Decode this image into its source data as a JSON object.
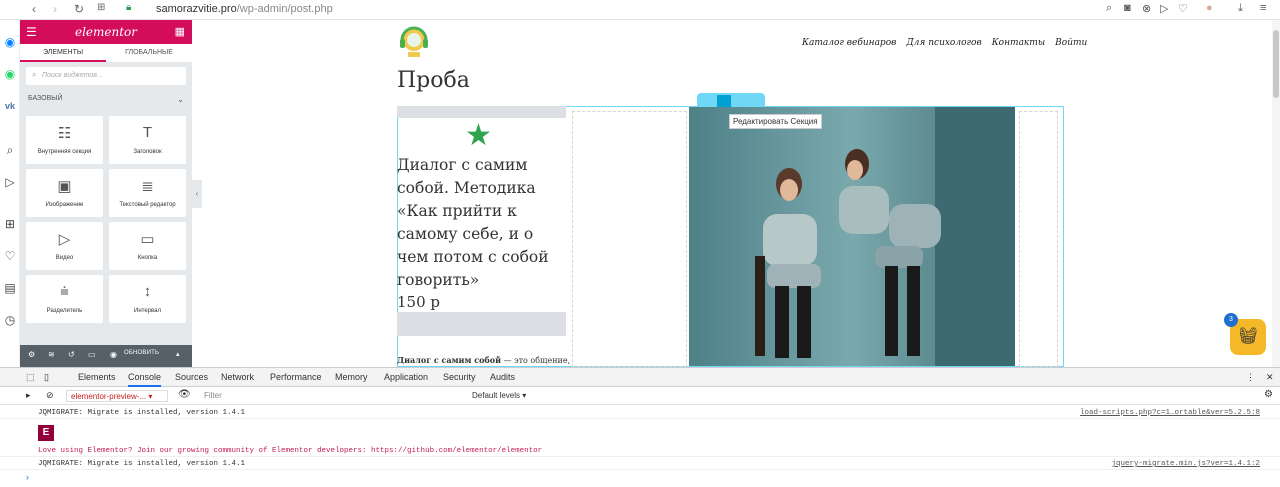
{
  "browser": {
    "url_host": "samorazvitie.pro",
    "url_path": "/wp-admin/post.php"
  },
  "panel": {
    "logo": "elementor",
    "tabs": [
      "ЭЛЕМЕНТЫ",
      "ГЛОБАЛЬНЫЕ"
    ],
    "search_placeholder": "Поиск виджетов...",
    "category": "БАЗОВЫЙ",
    "widgets": [
      {
        "label": "Внутренняя секция",
        "icon": "columns-icon"
      },
      {
        "label": "Заголовок",
        "icon": "heading-icon"
      },
      {
        "label": "Изображение",
        "icon": "image-icon"
      },
      {
        "label": "Текстовый редактор",
        "icon": "text-editor-icon"
      },
      {
        "label": "Видео",
        "icon": "video-icon"
      },
      {
        "label": "Кнопка",
        "icon": "button-icon"
      },
      {
        "label": "Разделитель",
        "icon": "divider-icon"
      },
      {
        "label": "Интервал",
        "icon": "spacer-icon"
      }
    ],
    "update_label": "ОБНОВИТЬ",
    "accent": "#d30c5c"
  },
  "site": {
    "nav": [
      "Каталог вебинаров",
      "Для психологов",
      "Контакты",
      "Войти"
    ],
    "page_title": "Проба",
    "edit_section_tooltip": "Редактировать Секция",
    "course_title": "Диалог с самим собой. Методика «Как прийти к самому себе, и о чем потом с собой говорить»",
    "price": "150 р",
    "desc_bold": "Диалог с самим собой",
    "desc_rest": " — это общение,",
    "cart_count": "3"
  },
  "devtools": {
    "tabs": [
      "Elements",
      "Console",
      "Sources",
      "Network",
      "Performance",
      "Memory",
      "Application",
      "Security",
      "Audits"
    ],
    "active_tab": "Console",
    "context": "elementor-preview-...",
    "filter_placeholder": "Filter",
    "levels": "Default levels ▾",
    "lines": [
      {
        "msg": "JQMIGRATE: Migrate is installed, version 1.4.1",
        "src": "load-scripts.php?c=1…ortable&ver=5.2.5:8"
      },
      {
        "msg": "Love using Elementor? Join our growing community of Elementor developers: https://github.com/elementor/elementor",
        "src": ""
      },
      {
        "msg": "JQMIGRATE: Migrate is installed, version 1.4.1",
        "src": "jquery-migrate.min.js?ver=1.4.1:2"
      }
    ]
  }
}
